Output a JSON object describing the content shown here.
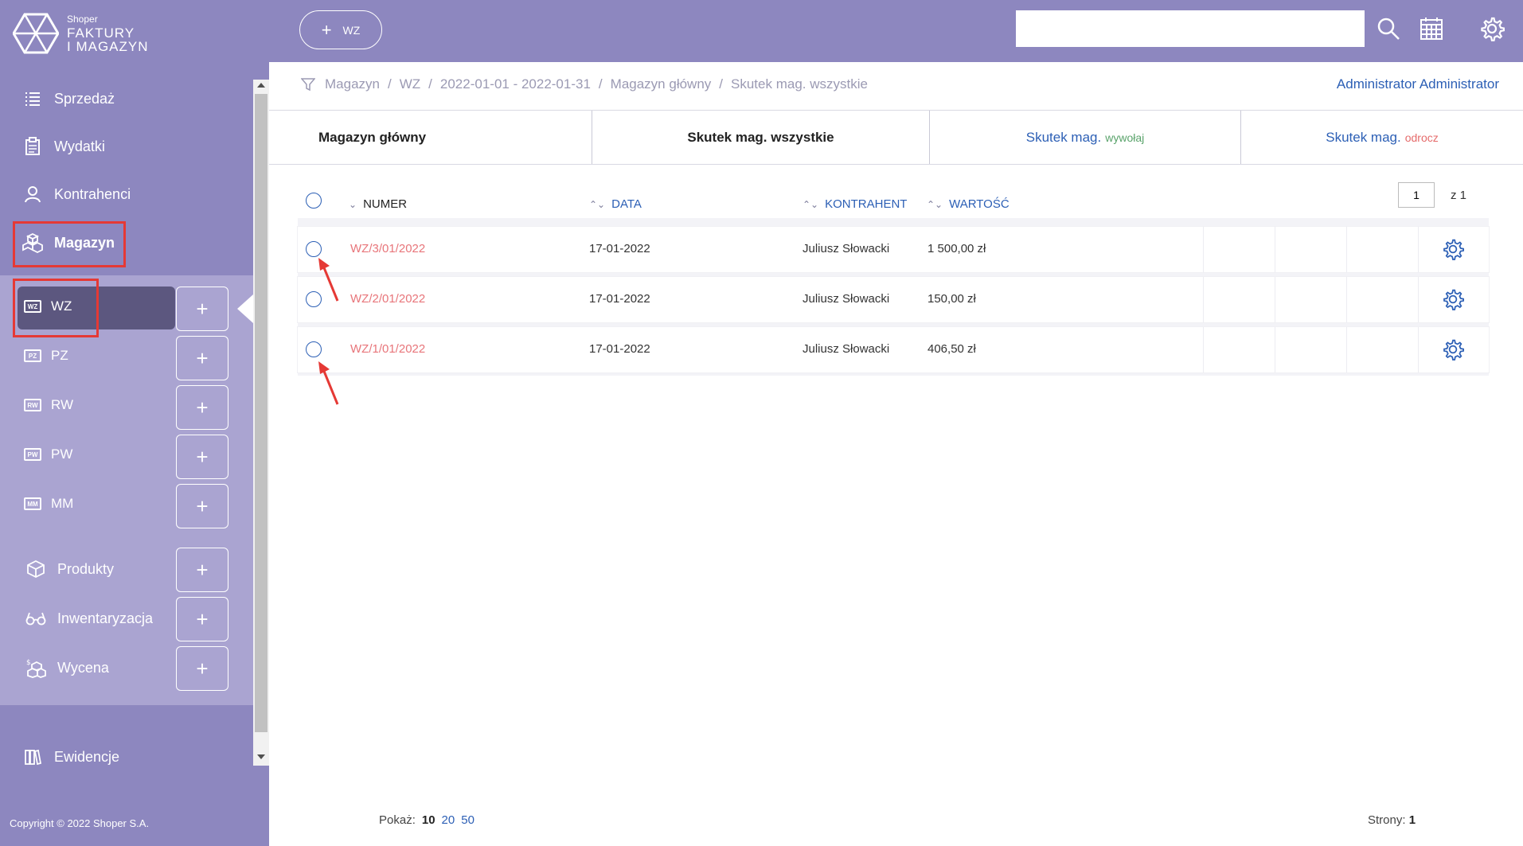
{
  "brand": {
    "small": "Shoper",
    "line1": "FAKTURY",
    "line2": "I MAGAZYN"
  },
  "nav": {
    "sprzedaz": "Sprzedaż",
    "wydatki": "Wydatki",
    "kontrahenci": "Kontrahenci",
    "magazyn": "Magazyn",
    "produkty": "Produkty",
    "inwentaryzacja": "Inwentaryzacja",
    "wycena": "Wycena",
    "ewidencje": "Ewidencje"
  },
  "subnav": [
    {
      "label": "WZ",
      "icon": "WZ"
    },
    {
      "label": "PZ",
      "icon": "PZ"
    },
    {
      "label": "RW",
      "icon": "RW"
    },
    {
      "label": "PW",
      "icon": "PW"
    },
    {
      "label": "MM",
      "icon": "MM"
    }
  ],
  "plus": "+",
  "copyright": "Copyright © 2022 Shoper S.A.",
  "topbar": {
    "new_button_plus": "+",
    "new_button_label": "WZ",
    "search_placeholder": ""
  },
  "breadcrumb": [
    "Magazyn",
    "WZ",
    "2022-01-01 - 2022-01-31",
    "Magazyn główny",
    "Skutek mag. wszystkie"
  ],
  "breadcrumb_sep": "/",
  "user": "Administrator Administrator",
  "tabs": {
    "t1": "Magazyn główny",
    "t2": "Skutek mag. wszystkie",
    "t3": "Skutek mag.",
    "t3_suffix": "wywołaj",
    "t4": "Skutek mag.",
    "t4_suffix": "odrocz"
  },
  "table": {
    "columns": {
      "numer": "NUMER",
      "data": "DATA",
      "kontrahent": "KONTRAHENT",
      "wartosc": "WARTOŚĆ"
    },
    "sort_desc": "⌄",
    "sort_both": "⌃⌄",
    "rows": [
      {
        "numer": "WZ/3/01/2022",
        "data": "17-01-2022",
        "kontrahent": "Juliusz Słowacki",
        "wartosc": "1 500,00 zł"
      },
      {
        "numer": "WZ/2/01/2022",
        "data": "17-01-2022",
        "kontrahent": "Juliusz Słowacki",
        "wartosc": "150,00 zł"
      },
      {
        "numer": "WZ/1/01/2022",
        "data": "17-01-2022",
        "kontrahent": "Juliusz Słowacki",
        "wartosc": "406,50 zł"
      }
    ]
  },
  "pagination": {
    "current": "1",
    "of": "z 1"
  },
  "footer": {
    "show_label": "Pokaż:",
    "sizes": [
      "10",
      "20",
      "50"
    ],
    "pages_label": "Strony:",
    "pages_value": "1"
  },
  "colors": {
    "sidebar": "#8d87bf",
    "subpanel": "#aaa4d1",
    "active": "#5c577f",
    "link": "#2c5fb5",
    "number": "#e8757a",
    "highlight": "#e53935"
  }
}
